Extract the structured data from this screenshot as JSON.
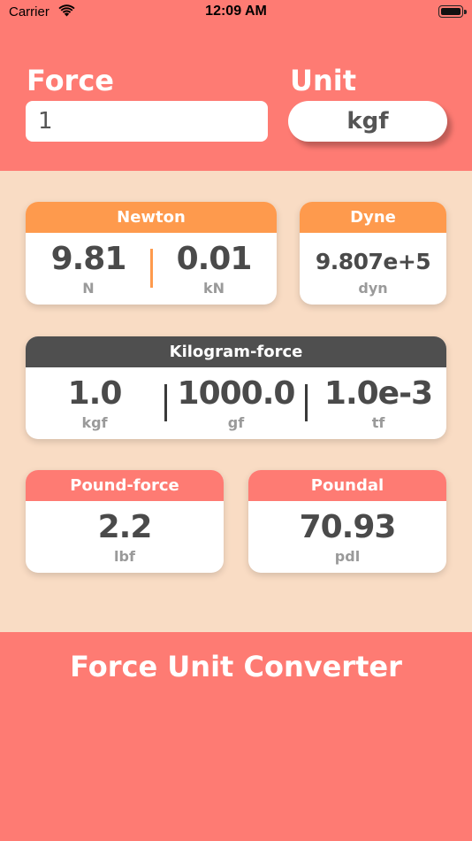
{
  "status_bar": {
    "carrier": "Carrier",
    "time": "12:09 AM"
  },
  "header": {
    "force_label": "Force",
    "unit_label": "Unit",
    "force_value": "1",
    "unit_value": "kgf"
  },
  "cards": {
    "newton": {
      "title": "Newton",
      "values": [
        {
          "value": "9.81",
          "unit": "N"
        },
        {
          "value": "0.01",
          "unit": "kN"
        }
      ]
    },
    "dyne": {
      "title": "Dyne",
      "value": "9.807e+5",
      "unit": "dyn"
    },
    "kilogram_force": {
      "title": "Kilogram-force",
      "values": [
        {
          "value": "1.0",
          "unit": "kgf"
        },
        {
          "value": "1000.0",
          "unit": "gf"
        },
        {
          "value": "1.0e-3",
          "unit": "tf"
        }
      ]
    },
    "pound_force": {
      "title": "Pound-force",
      "value": "2.2",
      "unit": "lbf"
    },
    "poundal": {
      "title": "Poundal",
      "value": "70.93",
      "unit": "pdl"
    }
  },
  "footer": {
    "title": "Force Unit Converter"
  },
  "colors": {
    "coral": "#fe7b73",
    "orange": "#fe9a4d",
    "dark": "#4f4f4f",
    "background": "#f9dcc4"
  },
  "icons": {
    "wifi": "wifi-icon",
    "battery": "battery-icon"
  }
}
